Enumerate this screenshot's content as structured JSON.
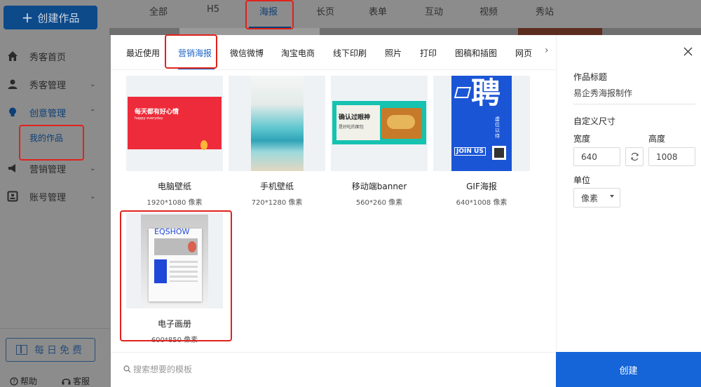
{
  "sidebar": {
    "create_label": "创建作品",
    "items": [
      {
        "label": "秀客首页",
        "icon": "home-icon"
      },
      {
        "label": "秀客管理",
        "icon": "user-icon"
      },
      {
        "label": "创意管理",
        "icon": "bulb-icon"
      },
      {
        "label": "营销管理",
        "icon": "megaphone-icon"
      },
      {
        "label": "账号管理",
        "icon": "account-icon"
      }
    ],
    "sub_item": "我的作品",
    "daily": "每日免费",
    "help": "帮助",
    "service": "客服"
  },
  "top_tabs": [
    "全部",
    "H5",
    "海报",
    "长页",
    "表单",
    "互动",
    "视频",
    "秀站"
  ],
  "modal": {
    "tabs": [
      "最近使用",
      "营销海报",
      "微信微博",
      "淘宝电商",
      "线下印刷",
      "照片",
      "打印",
      "图稿和插图",
      "网页"
    ],
    "cards": [
      {
        "name": "电脑壁纸",
        "dims": "1920*1080 像素",
        "thumb_text": "每天都有好心情",
        "thumb_sub": "happy everyday"
      },
      {
        "name": "手机壁纸",
        "dims": "720*1280 像素"
      },
      {
        "name": "移动端banner",
        "dims": "560*260 像素",
        "thumb_text": "确认过眼神",
        "thumb_sub": "是好吃的面包"
      },
      {
        "name": "GIF海报",
        "dims": "640*1008 像素",
        "thumb_text": "聘",
        "thumb_sub": "JOIN US",
        "thumb_side": "虚位以待"
      },
      {
        "name": "电子画册",
        "dims": "600*850 像素",
        "thumb_text": "EQSHOW"
      }
    ],
    "search_placeholder": "搜索想要的模板"
  },
  "panel": {
    "title_label": "作品标题",
    "title_value": "易企秀海报制作",
    "size_label": "自定义尺寸",
    "width_label": "宽度",
    "width_value": "640",
    "height_label": "高度",
    "height_value": "1008",
    "unit_label": "单位",
    "unit_value": "像素",
    "create_label": "创建"
  },
  "colors": {
    "accent": "#1565d8",
    "highlight": "#e0231c"
  }
}
